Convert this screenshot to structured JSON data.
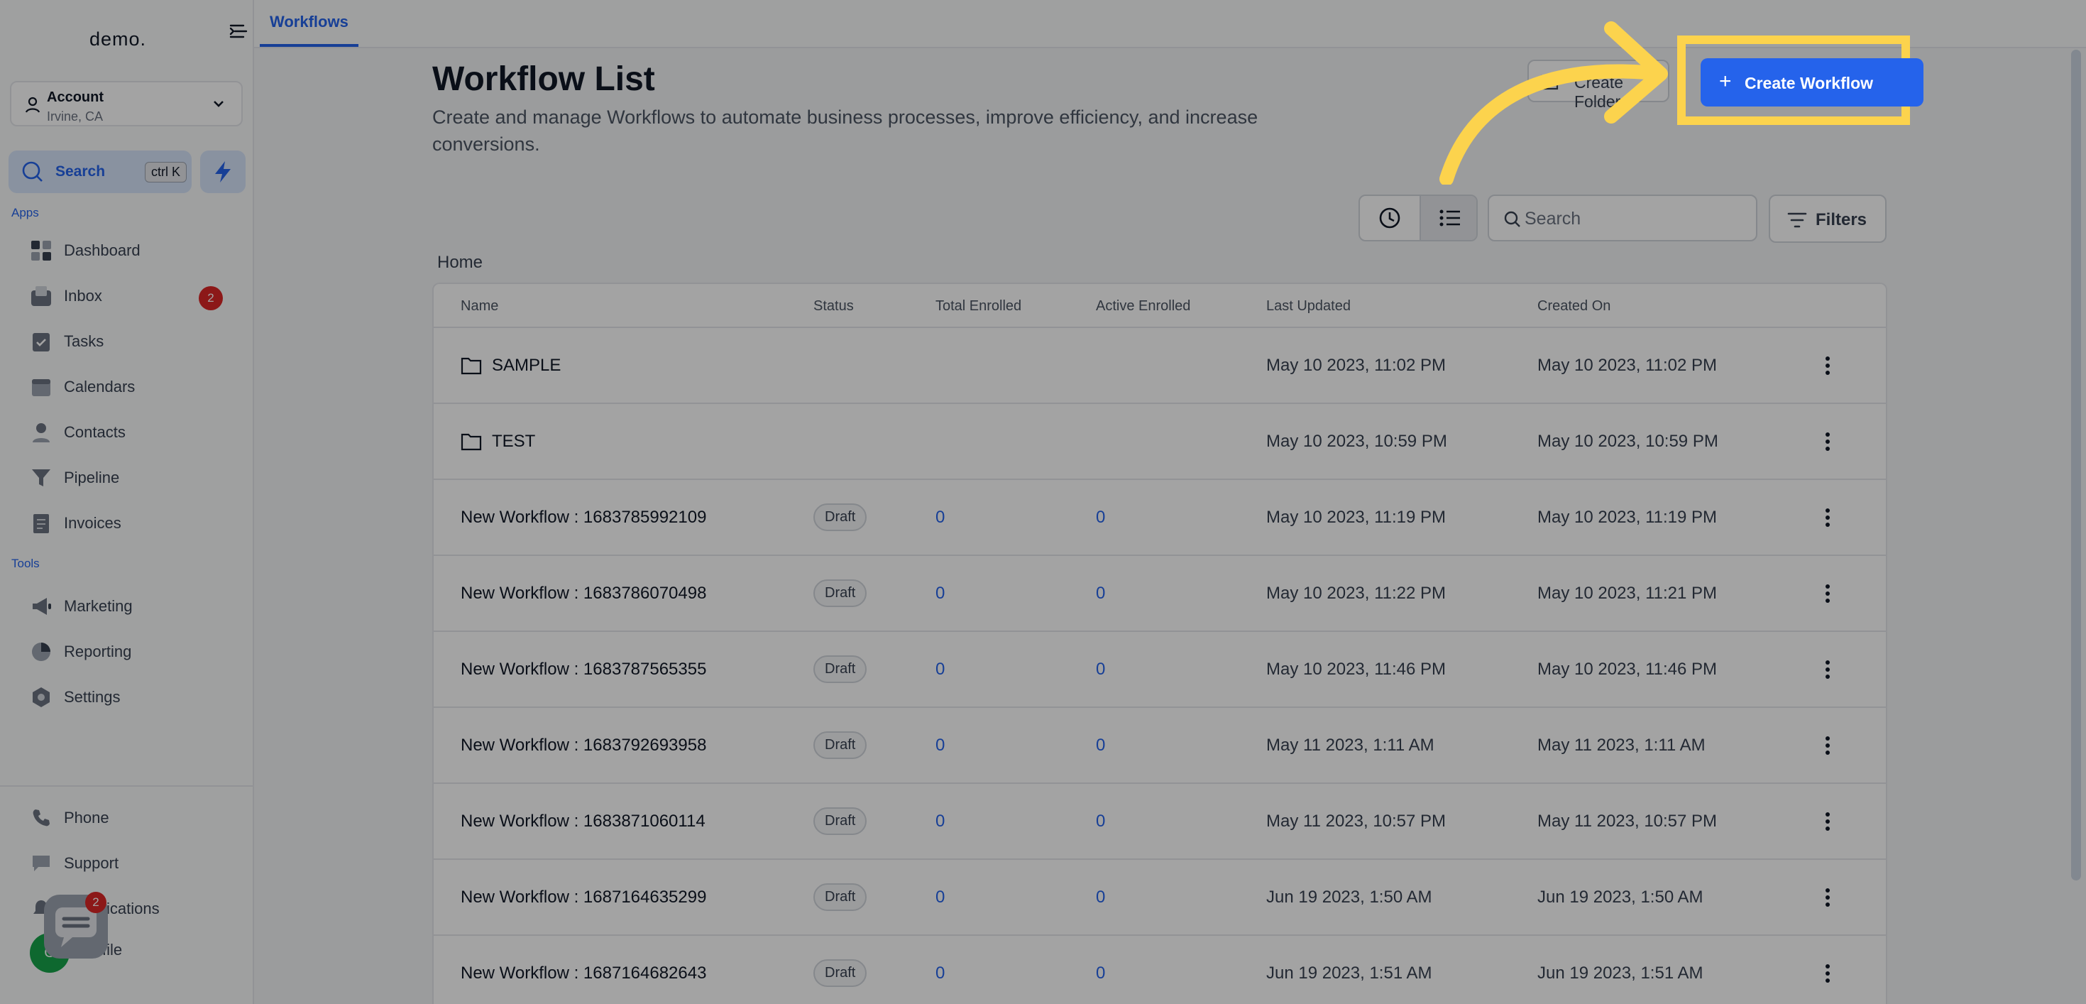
{
  "app": {
    "logo": "demo."
  },
  "account": {
    "name": "Account",
    "location": "Irvine, CA"
  },
  "search": {
    "label": "Search",
    "shortcut": "ctrl K"
  },
  "sidebar": {
    "apps_label": "Apps",
    "tools_label": "Tools",
    "apps": [
      {
        "label": "Dashboard",
        "icon": "dashboard-icon"
      },
      {
        "label": "Inbox",
        "icon": "inbox-icon",
        "badge": "2"
      },
      {
        "label": "Tasks",
        "icon": "tasks-icon"
      },
      {
        "label": "Calendars",
        "icon": "calendar-icon"
      },
      {
        "label": "Contacts",
        "icon": "contacts-icon"
      },
      {
        "label": "Pipeline",
        "icon": "pipeline-icon"
      },
      {
        "label": "Invoices",
        "icon": "invoice-icon"
      }
    ],
    "tools": [
      {
        "label": "Marketing",
        "icon": "megaphone-icon"
      },
      {
        "label": "Reporting",
        "icon": "pie-chart-icon"
      },
      {
        "label": "Settings",
        "icon": "gear-icon"
      }
    ],
    "bottom": [
      {
        "label": "Phone",
        "icon": "phone-icon"
      },
      {
        "label": "Support",
        "icon": "support-icon"
      },
      {
        "label": "ications",
        "icon": "bell-icon"
      },
      {
        "label": "file",
        "icon": "profile-icon"
      }
    ],
    "chat_badge": "2",
    "avatar_initials": "G"
  },
  "topbar": {
    "active_tab": "Workflows"
  },
  "main": {
    "title": "Workflow List",
    "description": "Create and manage Workflows to automate business processes, improve efficiency, and increase conversions.",
    "create_folder_label": "Create Folder",
    "create_workflow_label": "Create Workflow",
    "search_placeholder": "Search",
    "filters_label": "Filters",
    "breadcrumb": "Home"
  },
  "table": {
    "columns": [
      "Name",
      "Status",
      "Total Enrolled",
      "Active Enrolled",
      "Last Updated",
      "Created On"
    ],
    "rows": [
      {
        "type": "folder",
        "name": "SAMPLE",
        "status": "",
        "total": "",
        "active": "",
        "updated": "May 10 2023, 11:02 PM",
        "created": "May 10 2023, 11:02 PM"
      },
      {
        "type": "folder",
        "name": "TEST",
        "status": "",
        "total": "",
        "active": "",
        "updated": "May 10 2023, 10:59 PM",
        "created": "May 10 2023, 10:59 PM"
      },
      {
        "type": "workflow",
        "name": "New Workflow : 1683785992109",
        "status": "Draft",
        "total": "0",
        "active": "0",
        "updated": "May 10 2023, 11:19 PM",
        "created": "May 10 2023, 11:19 PM"
      },
      {
        "type": "workflow",
        "name": "New Workflow : 1683786070498",
        "status": "Draft",
        "total": "0",
        "active": "0",
        "updated": "May 10 2023, 11:22 PM",
        "created": "May 10 2023, 11:21 PM"
      },
      {
        "type": "workflow",
        "name": "New Workflow : 1683787565355",
        "status": "Draft",
        "total": "0",
        "active": "0",
        "updated": "May 10 2023, 11:46 PM",
        "created": "May 10 2023, 11:46 PM"
      },
      {
        "type": "workflow",
        "name": "New Workflow : 1683792693958",
        "status": "Draft",
        "total": "0",
        "active": "0",
        "updated": "May 11 2023, 1:11 AM",
        "created": "May 11 2023, 1:11 AM"
      },
      {
        "type": "workflow",
        "name": "New Workflow : 1683871060114",
        "status": "Draft",
        "total": "0",
        "active": "0",
        "updated": "May 11 2023, 10:57 PM",
        "created": "May 11 2023, 10:57 PM"
      },
      {
        "type": "workflow",
        "name": "New Workflow : 1687164635299",
        "status": "Draft",
        "total": "0",
        "active": "0",
        "updated": "Jun 19 2023, 1:50 AM",
        "created": "Jun 19 2023, 1:50 AM"
      },
      {
        "type": "workflow",
        "name": "New Workflow : 1687164682643",
        "status": "Draft",
        "total": "0",
        "active": "0",
        "updated": "Jun 19 2023, 1:51 AM",
        "created": "Jun 19 2023, 1:51 AM"
      }
    ]
  },
  "colors": {
    "primary": "#2563eb",
    "highlight": "#fcd34d",
    "badge": "#dc2626"
  }
}
